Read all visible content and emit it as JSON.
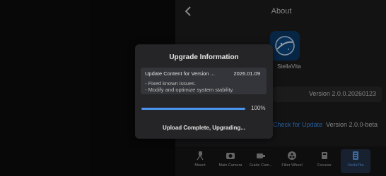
{
  "header": {
    "back_icon": "chevron-left-icon",
    "title": "About"
  },
  "app": {
    "name": "StellaVita",
    "logo_icon": "stellavita-logo-icon",
    "version": "Version 2.0.0.20260123",
    "check_update_label": "Check for Update",
    "beta_version": "Version 2.0.0-beta"
  },
  "nav": {
    "items": [
      {
        "label": "Mount",
        "icon": "mount-icon"
      },
      {
        "label": "Main Camera",
        "icon": "camera-icon"
      },
      {
        "label": "Guide Cam...",
        "icon": "guide-camera-icon"
      },
      {
        "label": "Filter Wheel",
        "icon": "filter-wheel-icon"
      },
      {
        "label": "Focuser",
        "icon": "focuser-icon"
      },
      {
        "label": "StellaVita",
        "icon": "stellavita-icon"
      }
    ],
    "active": "StellaVita"
  },
  "modal": {
    "title": "Upgrade Information",
    "content_header": "Update Content for Version ...",
    "content_date": "2026.01.09",
    "content_lines": [
      "- Fixed known issues.",
      "- Modify and optimize system stability."
    ],
    "progress": 1.0,
    "progress_label": "100%",
    "status": "Upload Complete, Upgrading..."
  },
  "colors": {
    "accent": "#4a96ef",
    "link": "#3b8ff0",
    "modal_bg": "#252527"
  }
}
